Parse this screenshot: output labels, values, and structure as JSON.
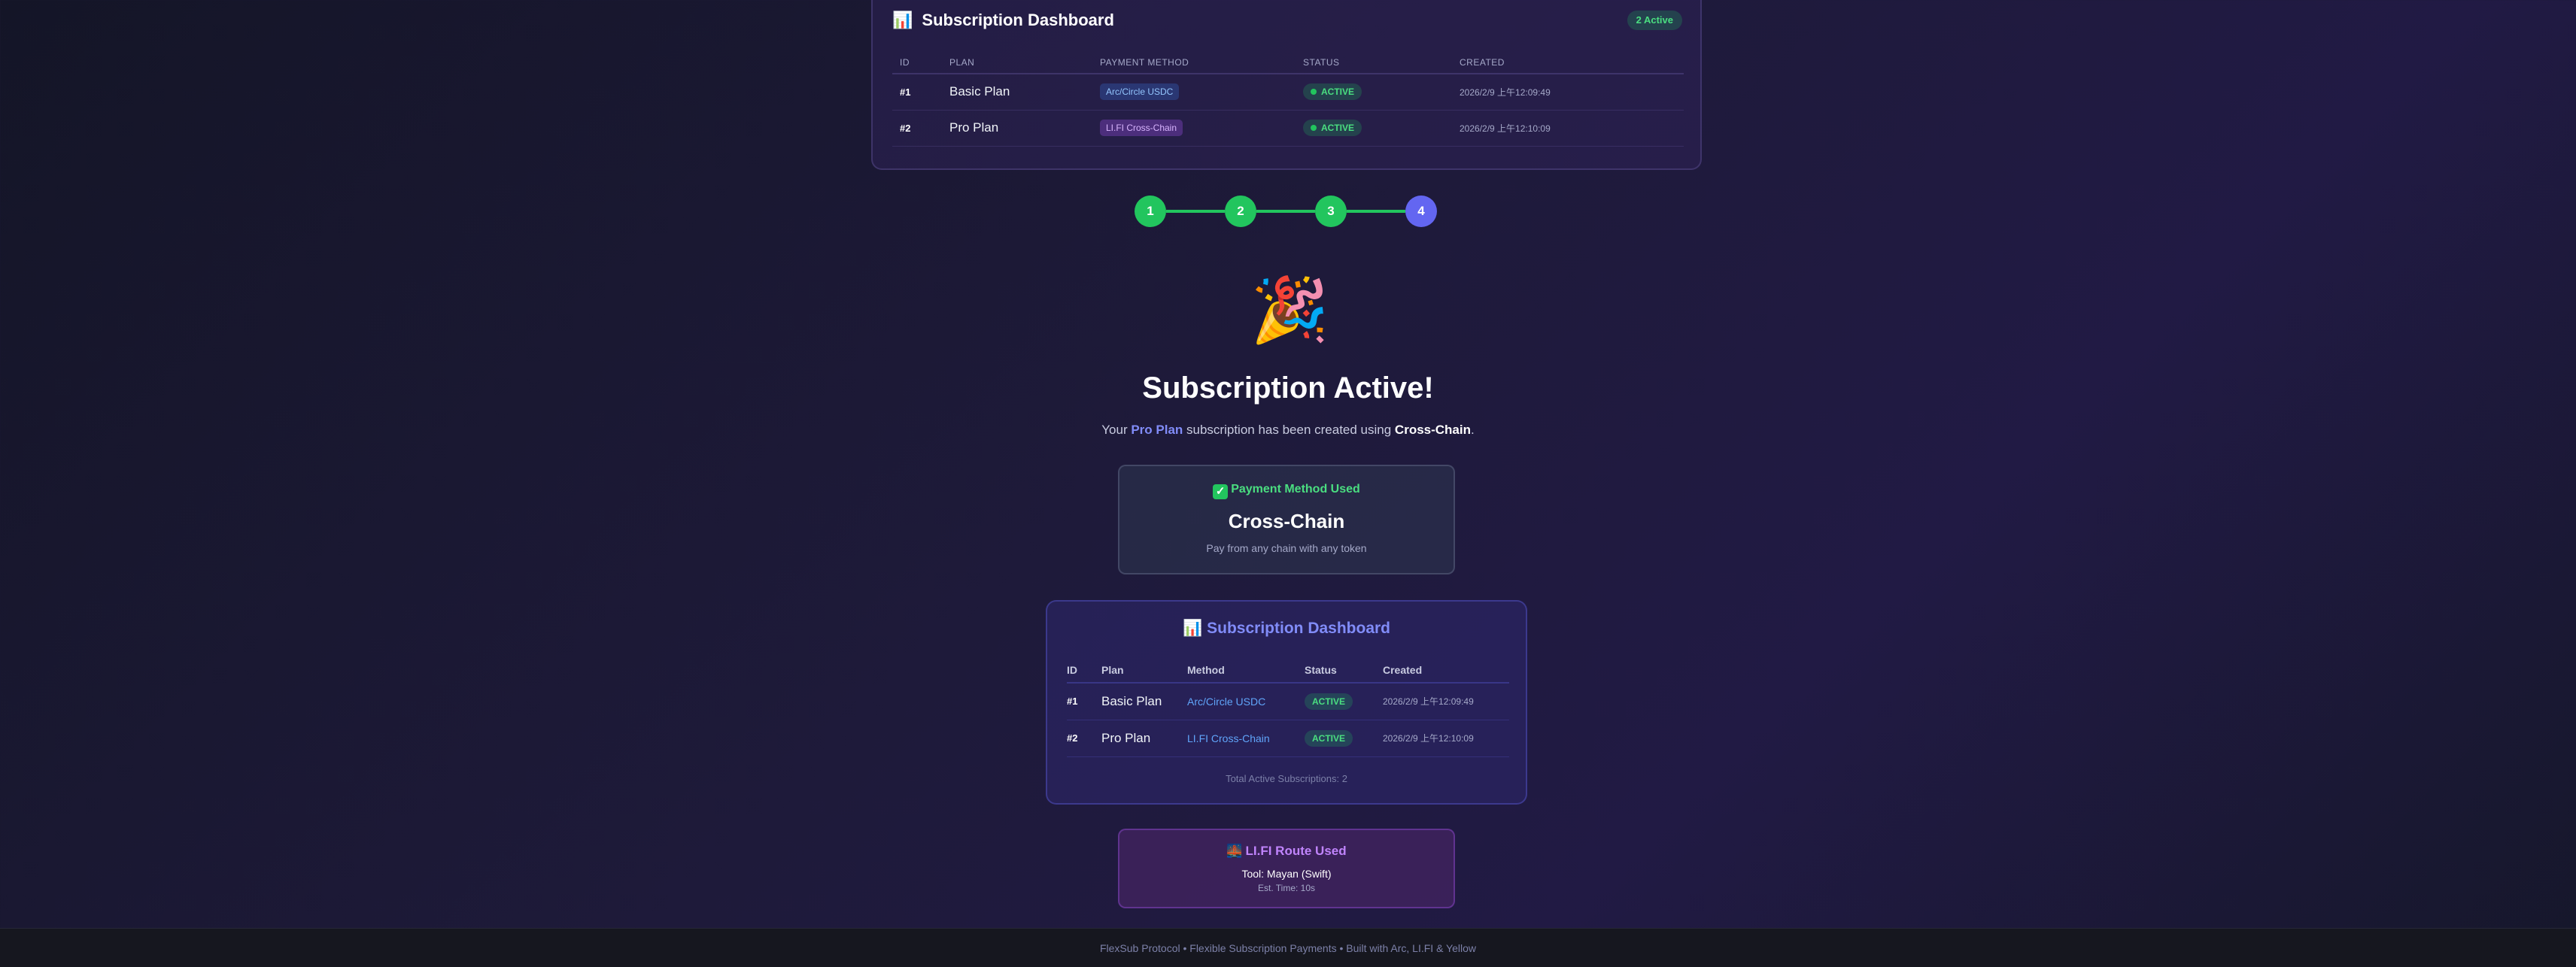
{
  "top_dashboard": {
    "icon": "bar-chart-icon",
    "emoji": "📊",
    "title": "Subscription Dashboard",
    "badge": "2 Active",
    "headers": {
      "id": "ID",
      "plan": "PLAN",
      "payment_method": "PAYMENT METHOD",
      "status": "STATUS",
      "created": "CREATED"
    },
    "rows": [
      {
        "id": "#1",
        "plan": "Basic Plan",
        "method": "Arc/Circle USDC",
        "status": "ACTIVE",
        "created": "2026/2/9 上午12:09:49"
      },
      {
        "id": "#2",
        "plan": "Pro Plan",
        "method": "LI.FI Cross-Chain",
        "status": "ACTIVE",
        "created": "2026/2/9 上午12:10:09"
      }
    ]
  },
  "stepper": {
    "steps": [
      "1",
      "2",
      "3",
      "4"
    ],
    "current": 4,
    "completed_color": "#22c55e",
    "current_color": "#6366f1"
  },
  "success": {
    "icon": "party-popper-icon",
    "emoji": "🎉",
    "headline": "Subscription Active!",
    "sub_prefix": "Your ",
    "plan_name": "Pro Plan",
    "sub_middle": " subscription has been created using ",
    "method_name": "Cross-Chain",
    "sub_suffix": "."
  },
  "payment_card": {
    "icon": "check-mark-icon",
    "label": "Payment Method Used",
    "method": "Cross-Chain",
    "description": "Pay from any chain with any token"
  },
  "bottom_dashboard": {
    "icon": "bar-chart-icon",
    "emoji": "📊",
    "title": "Subscription Dashboard",
    "headers": {
      "id": "ID",
      "plan": "Plan",
      "method": "Method",
      "status": "Status",
      "created": "Created"
    },
    "rows": [
      {
        "id": "#1",
        "plan": "Basic Plan",
        "method": "Arc/Circle USDC",
        "status": "ACTIVE",
        "created": "2026/2/9 上午12:09:49"
      },
      {
        "id": "#2",
        "plan": "Pro Plan",
        "method": "LI.FI Cross-Chain",
        "status": "ACTIVE",
        "created": "2026/2/9 上午12:10:09"
      }
    ],
    "total": "Total Active Subscriptions: 2"
  },
  "route_card": {
    "icon": "bridge-icon",
    "emoji": "🌉",
    "title": "LI.FI Route Used",
    "tool": "Tool: Mayan (Swift)",
    "eta": "Est. Time: 10s"
  },
  "footer": {
    "text": "FlexSub Protocol • Flexible Subscription Payments • Built with Arc, LI.FI & Yellow"
  },
  "colors": {
    "accent": "#6366f1",
    "success": "#22c55e",
    "link": "#60a5fa",
    "purple": "#c084fc"
  }
}
